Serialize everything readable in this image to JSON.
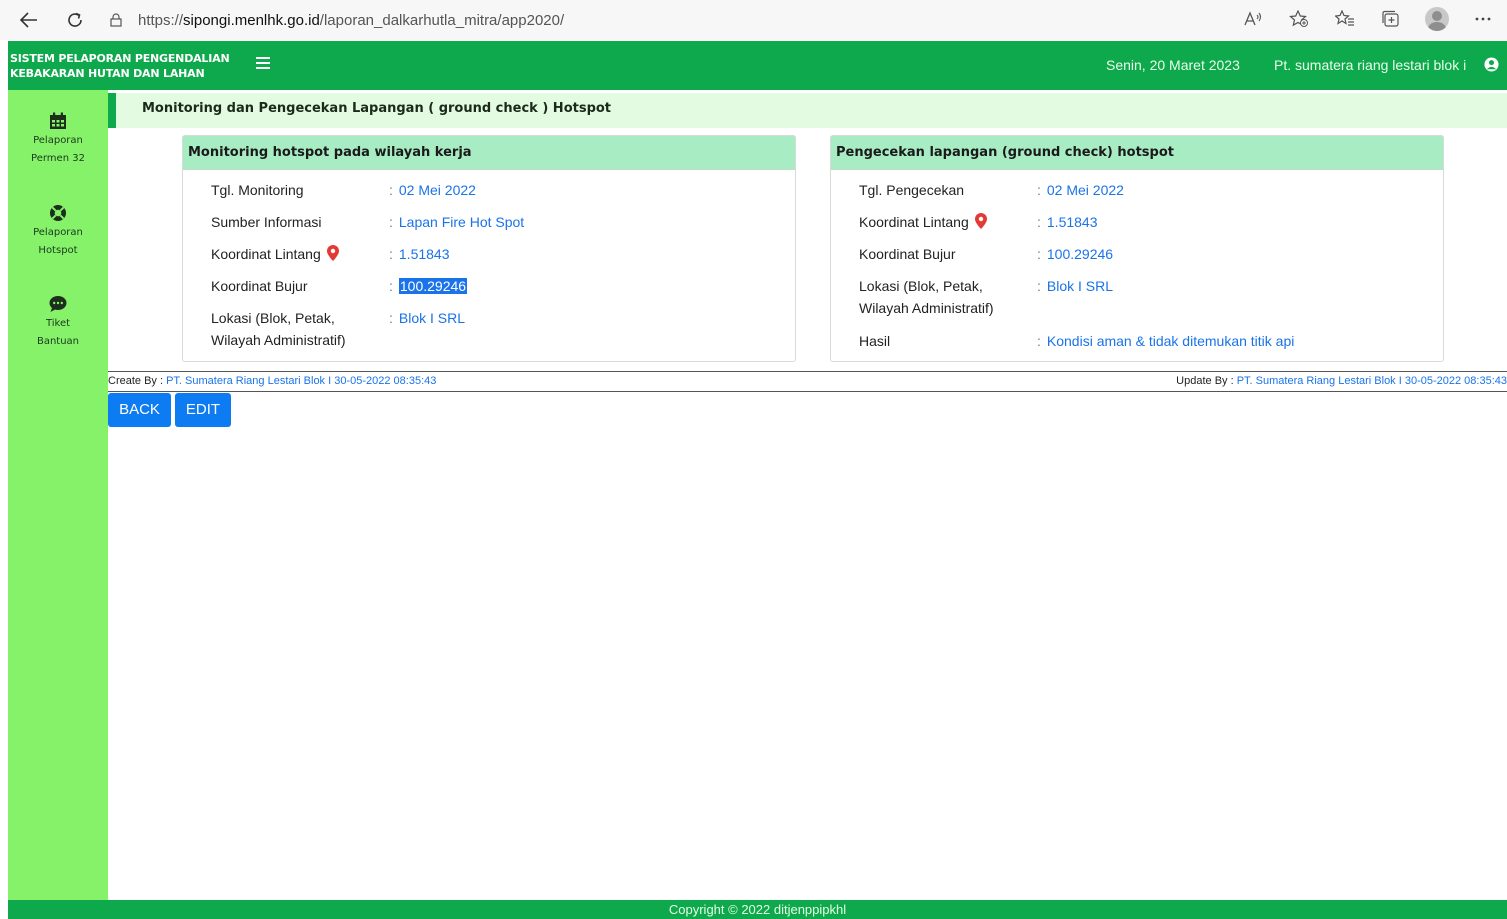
{
  "browser": {
    "url_proto": "https://",
    "url_host": "sipongi.menlhk.go.id",
    "url_path": "/laporan_dalkarhutla_mitra/app2020/"
  },
  "header": {
    "brand_line1": "SISTEM PELAPORAN PENGENDALIAN",
    "brand_line2": "KEBAKARAN HUTAN DAN LAHAN",
    "date": "Senin, 20 Maret 2023",
    "user": "Pt. sumatera riang lestari blok i"
  },
  "sidebar": {
    "items": [
      {
        "line1": "Pelaporan",
        "line2": "Permen 32",
        "icon": "calendar-icon"
      },
      {
        "line1": "Pelaporan",
        "line2": "Hotspot",
        "icon": "lifebuoy-icon"
      },
      {
        "line1": "Tiket",
        "line2": "Bantuan",
        "icon": "chat-bubble-icon"
      }
    ]
  },
  "page_title": "Monitoring dan Pengecekan Lapangan ( ground check ) Hotspot",
  "monitoring": {
    "title": "Monitoring hotspot pada wilayah kerja",
    "tgl_label": "Tgl. Monitoring",
    "tgl_value": "02 Mei 2022",
    "sumber_label": "Sumber Informasi",
    "sumber_value": "Lapan Fire Hot Spot",
    "lintang_label": "Koordinat Lintang",
    "lintang_value": "1.51843",
    "bujur_label": "Koordinat Bujur",
    "bujur_value": "100.29246",
    "lokasi_label_1": "Lokasi (Blok, Petak,",
    "lokasi_label_2": "Wilayah Administratif)",
    "lokasi_value": "Blok I SRL"
  },
  "groundcheck": {
    "title": "Pengecekan lapangan (ground check) hotspot",
    "tgl_label": "Tgl. Pengecekan",
    "tgl_value": "02 Mei 2022",
    "lintang_label": "Koordinat Lintang",
    "lintang_value": "1.51843",
    "bujur_label": "Koordinat Bujur",
    "bujur_value": "100.29246",
    "lokasi_label_1": "Lokasi (Blok, Petak,",
    "lokasi_label_2": "Wilayah Administratif)",
    "lokasi_value": "Blok I SRL",
    "hasil_label": "Hasil",
    "hasil_value": "Kondisi aman & tidak ditemukan titik api"
  },
  "colon": ":",
  "audit": {
    "create_label": "Create By :",
    "create_value": "PT. Sumatera Riang Lestari Blok I 30-05-2022 08:35:43",
    "update_label": "Update By :",
    "update_value": "PT. Sumatera Riang Lestari Blok I 30-05-2022 08:35:43"
  },
  "buttons": {
    "back": "BACK",
    "edit": "EDIT"
  },
  "footer": "Copyright © 2022 ditjenppipkhl",
  "colors": {
    "header_green": "#0ea94c",
    "sidebar_green": "#86f26a",
    "panel_head": "#a8ecc4",
    "link_blue": "#1a73e8",
    "button_blue": "#0d7cf2",
    "pin_red": "#e53935"
  }
}
